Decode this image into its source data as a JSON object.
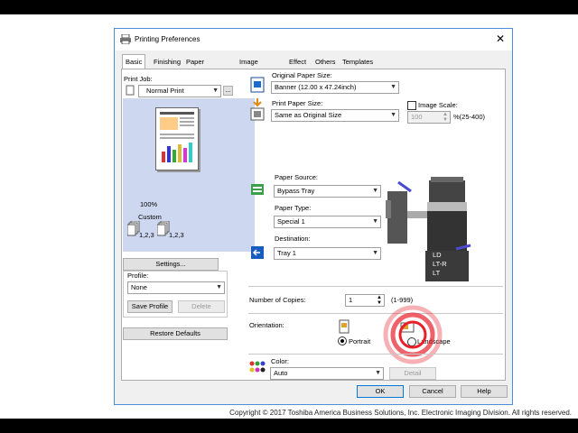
{
  "window": {
    "title": "Printing Preferences",
    "close": "✕"
  },
  "tabs": [
    "Basic",
    "Finishing",
    "Paper Handling",
    "Image Quality",
    "Effect",
    "Others",
    "Templates"
  ],
  "print_job": {
    "label": "Print Job:",
    "value": "Normal Print",
    "more": "..."
  },
  "preview": {
    "zoom": "100%",
    "mode": "Custom",
    "collate_a": "1,2,3",
    "collate_b": "1,2,3"
  },
  "settings_button": "Settings...",
  "profile": {
    "label": "Profile:",
    "value": "None",
    "save": "Save Profile",
    "delete": "Delete"
  },
  "restore_defaults": "Restore Defaults",
  "original_paper_size": {
    "label": "Original Paper Size:",
    "value": "Banner (12.00 x 47.24inch)"
  },
  "print_paper_size": {
    "label": "Print Paper Size:",
    "value": "Same as Original Size"
  },
  "image_scale": {
    "label": "Image Scale:",
    "value": "100",
    "range": "%(25-400)"
  },
  "paper_source": {
    "label": "Paper Source:",
    "value": "Bypass Tray"
  },
  "paper_type": {
    "label": "Paper Type:",
    "value": "Special 1"
  },
  "destination": {
    "label": "Destination:",
    "value": "Tray 1"
  },
  "printer_labels": [
    "LD",
    "LT-R",
    "LT"
  ],
  "copies": {
    "label": "Number of Copies:",
    "value": "1",
    "range": "(1-999)"
  },
  "orientation": {
    "label": "Orientation:",
    "portrait": "Portrait",
    "landscape": "Landscape",
    "selected": "portrait"
  },
  "color": {
    "label": "Color:",
    "value": "Auto",
    "detail_button": "Detail"
  },
  "buttons": {
    "ok": "OK",
    "cancel": "Cancel",
    "help": "Help"
  },
  "copyright": "Copyright © 2017 Toshiba America Business Solutions, Inc. Electronic Imaging Division. All rights reserved.",
  "colors": {
    "focus_ring": "#e8202a",
    "preview_bg": "#cdd8f0",
    "window_border": "#4a90d9"
  }
}
